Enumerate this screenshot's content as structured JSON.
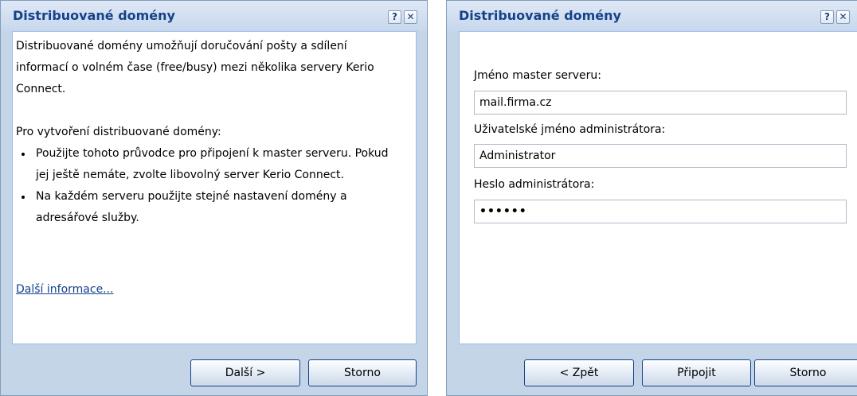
{
  "dialog1": {
    "title": "Distribuované domény",
    "help_icon": "?",
    "close_icon": "✕",
    "intro_paragraph": "Distribuované domény umožňují doručování pošty a sdílení informací o volném čase (free/busy) mezi několika servery Kerio Connect.",
    "steps_heading": "Pro vytvoření distribuované domény:",
    "steps": [
      "Použijte tohoto průvodce pro připojení k master serveru. Pokud jej ještě nemáte, zvolte libovolný server Kerio Connect.",
      "Na každém serveru použijte stejné nastavení domény a adresářové služby."
    ],
    "more_info_link": "Další informace...",
    "buttons": {
      "next": "Další >",
      "cancel": "Storno"
    }
  },
  "dialog2": {
    "title": "Distribuované domény",
    "help_icon": "?",
    "close_icon": "✕",
    "fields": {
      "master_label": "Jméno master serveru:",
      "master_value": "mail.firma.cz",
      "user_label": "Uživatelské jméno administrátora:",
      "user_value": "Administrator",
      "password_label": "Heslo administrátora:",
      "password_value": "••••••"
    },
    "buttons": {
      "back": "< Zpět",
      "connect": "Připojit",
      "cancel": "Storno"
    }
  },
  "colors": {
    "title_text": "#15428b",
    "dialog_background": "#c5d5e8",
    "border": "#99bbe8"
  }
}
